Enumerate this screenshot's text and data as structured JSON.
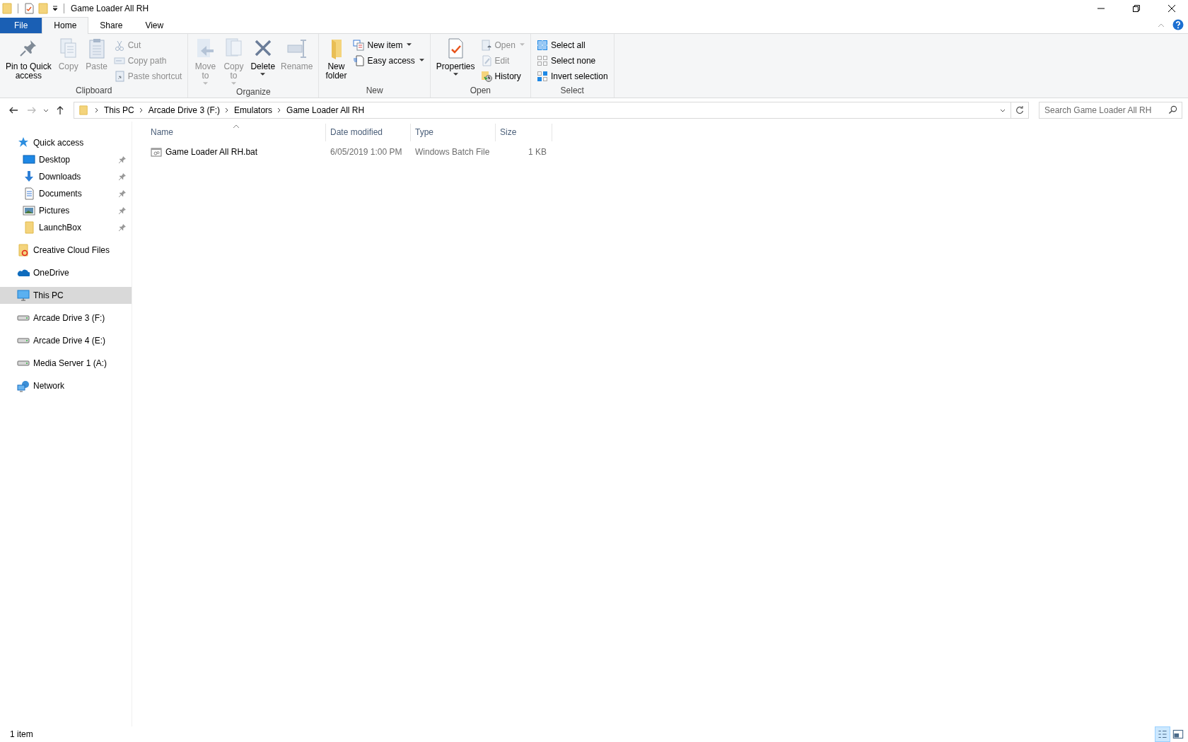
{
  "window": {
    "title": "Game Loader All RH"
  },
  "ribbon_tabs": [
    {
      "label": "File",
      "kind": "file",
      "selected": false
    },
    {
      "label": "Home",
      "kind": "tab",
      "selected": true
    },
    {
      "label": "Share",
      "kind": "tab",
      "selected": false
    },
    {
      "label": "View",
      "kind": "tab",
      "selected": false
    }
  ],
  "ribbon_groups": [
    {
      "label": "Clipboard",
      "buttons": [
        {
          "kind": "large",
          "label": "Pin to Quick\naccess",
          "disabled": false,
          "dropdown": false
        },
        {
          "kind": "large",
          "label": "Copy",
          "disabled": true,
          "dropdown": false
        },
        {
          "kind": "large",
          "label": "Paste",
          "disabled": true,
          "dropdown": false
        },
        {
          "kind": "stack",
          "items": [
            {
              "label": "Cut",
              "disabled": true,
              "dropdown": false
            },
            {
              "label": "Copy path",
              "disabled": true,
              "dropdown": false
            },
            {
              "label": "Paste shortcut",
              "disabled": true,
              "dropdown": false
            }
          ]
        }
      ]
    },
    {
      "label": "Organize",
      "buttons": [
        {
          "kind": "large",
          "label": "Move\nto",
          "disabled": true,
          "dropdown": true
        },
        {
          "kind": "large",
          "label": "Copy\nto",
          "disabled": true,
          "dropdown": true
        },
        {
          "kind": "large",
          "label": "Delete",
          "disabled": false,
          "dropdown": true
        },
        {
          "kind": "large",
          "label": "Rename",
          "disabled": true,
          "dropdown": false
        }
      ]
    },
    {
      "label": "New",
      "buttons": [
        {
          "kind": "large",
          "label": "New\nfolder",
          "disabled": false,
          "dropdown": false
        },
        {
          "kind": "stack",
          "items": [
            {
              "label": "New item",
              "disabled": false,
              "dropdown": true
            },
            {
              "label": "Easy access",
              "disabled": false,
              "dropdown": true
            }
          ]
        }
      ]
    },
    {
      "label": "Open",
      "buttons": [
        {
          "kind": "large",
          "label": "Properties",
          "disabled": false,
          "dropdown": true
        },
        {
          "kind": "stack",
          "items": [
            {
              "label": "Open",
              "disabled": true,
              "dropdown": true
            },
            {
              "label": "Edit",
              "disabled": true,
              "dropdown": false
            },
            {
              "label": "History",
              "disabled": false,
              "dropdown": false
            }
          ]
        }
      ]
    },
    {
      "label": "Select",
      "buttons": [
        {
          "kind": "stack",
          "items": [
            {
              "label": "Select all",
              "disabled": false,
              "dropdown": false
            },
            {
              "label": "Select none",
              "disabled": false,
              "dropdown": false
            },
            {
              "label": "Invert selection",
              "disabled": false,
              "dropdown": false
            }
          ]
        }
      ]
    }
  ],
  "address": {
    "breadcrumb": [
      "This PC",
      "Arcade Drive 3 (F:)",
      "Emulators",
      "Game Loader All RH"
    ]
  },
  "search": {
    "placeholder": "Search Game Loader All RH"
  },
  "sidebar": {
    "items": [
      {
        "label": "Quick access",
        "selected": false,
        "children": [
          {
            "label": "Desktop",
            "pinned": true,
            "selected": false
          },
          {
            "label": "Downloads",
            "pinned": true,
            "selected": false
          },
          {
            "label": "Documents",
            "pinned": true,
            "selected": false
          },
          {
            "label": "Pictures",
            "pinned": true,
            "selected": false
          },
          {
            "label": "LaunchBox",
            "pinned": true,
            "selected": false
          }
        ]
      },
      {
        "label": "Creative Cloud Files",
        "selected": false
      },
      {
        "label": "OneDrive",
        "selected": false
      },
      {
        "label": "This PC",
        "selected": true
      },
      {
        "label": "Arcade Drive 3 (F:)",
        "selected": false
      },
      {
        "label": "Arcade Drive 4 (E:)",
        "selected": false
      },
      {
        "label": "Media Server 1 (A:)",
        "selected": false
      },
      {
        "label": "Network",
        "selected": false
      }
    ]
  },
  "table": {
    "columns": [
      {
        "label": "Name",
        "sorted": true
      },
      {
        "label": "Date modified",
        "sorted": false
      },
      {
        "label": "Type",
        "sorted": false
      },
      {
        "label": "Size",
        "sorted": false
      }
    ],
    "rows": [
      {
        "name": "Game Loader All RH.bat",
        "date_modified": "6/05/2019 1:00 PM",
        "type": "Windows Batch File",
        "size": "1 KB",
        "selected": false
      }
    ]
  },
  "status_bar": {
    "text": "1 item",
    "views": [
      {
        "selected": true
      },
      {
        "selected": false
      }
    ]
  }
}
